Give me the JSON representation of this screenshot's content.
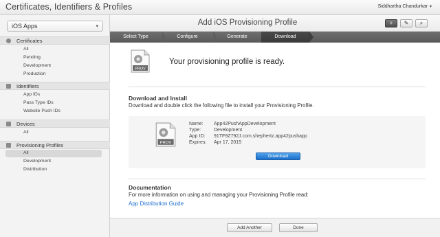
{
  "app": {
    "title": "Certificates, Identifiers & Profiles",
    "user": "Siddhartha Chandurkar",
    "user_caret": "▾"
  },
  "sidebar": {
    "platform": "iOS Apps",
    "platform_caret": "▾",
    "sections": [
      {
        "label": "Certificates",
        "icon": "certificate-icon",
        "items": [
          "All",
          "Pending",
          "Development",
          "Production"
        ]
      },
      {
        "label": "Identifiers",
        "icon": "id-icon",
        "items": [
          "App IDs",
          "Pass Type IDs",
          "Website Push IDs"
        ]
      },
      {
        "label": "Devices",
        "icon": "device-icon",
        "items": [
          "All"
        ]
      },
      {
        "label": "Provisioning Profiles",
        "icon": "profile-icon",
        "items": [
          "All",
          "Development",
          "Distribution"
        ]
      }
    ],
    "active": "Provisioning Profiles / All"
  },
  "header": {
    "title": "Add iOS Provisioning Profile",
    "buttons": [
      {
        "icon": "plus-icon",
        "glyph": "+"
      },
      {
        "icon": "edit-icon",
        "glyph": "✎"
      },
      {
        "icon": "search-icon",
        "glyph": "⌕"
      }
    ]
  },
  "steps": [
    "Select Type",
    "Configure",
    "Generate",
    "Download"
  ],
  "active_step": "Download",
  "ready": {
    "message": "Your provisioning profile is ready.",
    "icon_label": "PROV"
  },
  "download": {
    "heading": "Download and Install",
    "instruction": "Download and double click the following file to install your Provisioning Profile.",
    "name_label": "Name:",
    "name": "App42PushAppDevelopment",
    "type_label": "Type:",
    "type": "Development",
    "appid_label": "App ID:",
    "appid": "91TF9Z792J.com.shephertz.app42pushapp",
    "expires_label": "Expires:",
    "expires": "Apr 17, 2015",
    "button": "Download",
    "icon_label": "PROV"
  },
  "documentation": {
    "heading": "Documentation",
    "text": "For more information on using and managing your Provisioning Profile read:",
    "link": "App Distribution Guide"
  },
  "footer": {
    "add_another": "Add Another",
    "done": "Done"
  },
  "colors": {
    "accent": "#1a6dcc",
    "button_blue": "#2a7fd6",
    "steps_bar": "#636363"
  }
}
